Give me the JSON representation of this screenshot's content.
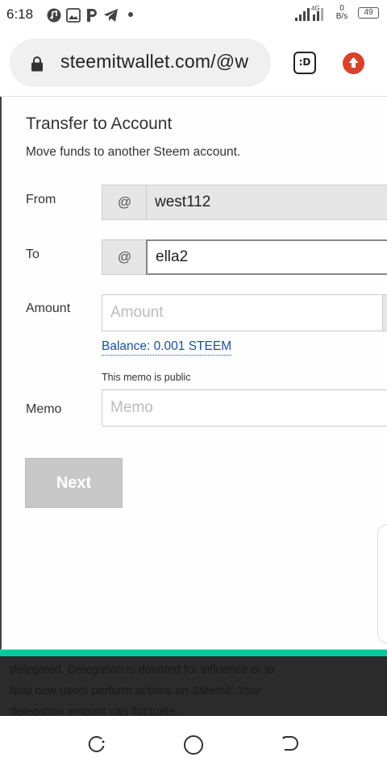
{
  "status_bar": {
    "time": "6:18",
    "network": "4G",
    "speed_value": "0",
    "speed_unit": "B/s",
    "battery": "49"
  },
  "browser": {
    "url": "steemitwallet.com/@w",
    "tab_label": ":D"
  },
  "transfer": {
    "title": "Transfer to Account",
    "subtitle": "Move funds to another Steem account.",
    "from_label": "From",
    "from_prefix": "@",
    "from_value": "west112",
    "to_label": "To",
    "to_prefix": "@",
    "to_value": "ella2",
    "amount_label": "Amount",
    "amount_placeholder": "Amount",
    "balance": "Balance: 0.001 STEEM",
    "memo_hint": "This memo is public",
    "memo_label": "Memo",
    "memo_placeholder": "Memo",
    "next_label": "Next"
  },
  "background_text": {
    "lines": [
      "delegated. Delegation is donated for influence or to",
      "help new users perform actions on Steemit. Your",
      "delegation amount can fluctuate."
    ]
  },
  "colors": {
    "accent": "#07c8a2",
    "link": "#1a5099",
    "upload": "#d9412b"
  }
}
